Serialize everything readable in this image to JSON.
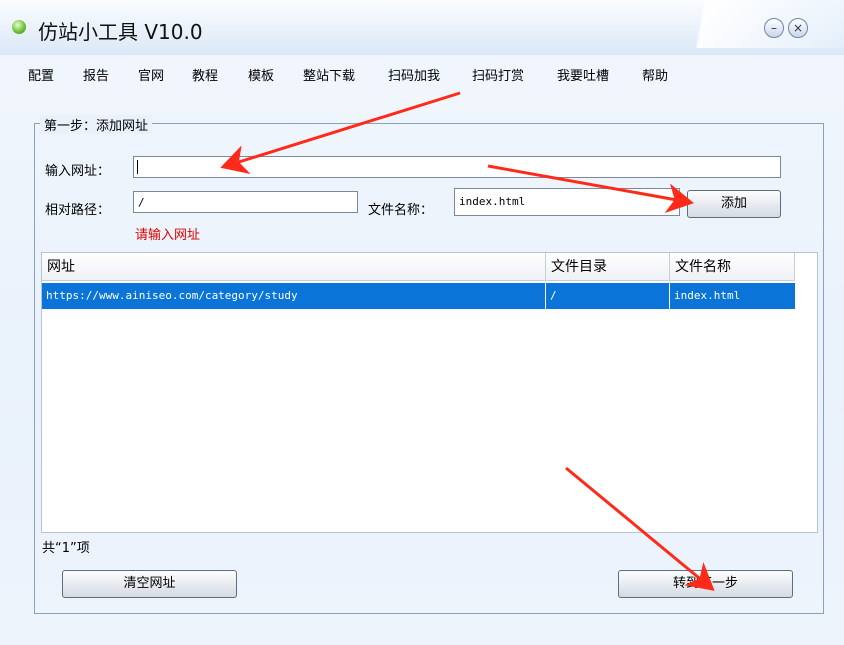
{
  "window": {
    "title": "仿站小工具 V10.0",
    "controls": {
      "minimize": "–",
      "close": "×"
    }
  },
  "menu": [
    "配置",
    "报告",
    "官网",
    "教程",
    "模板",
    "整站下载",
    "扫码加我",
    "扫码打赏",
    "我要吐槽",
    "帮助"
  ],
  "step": {
    "legend": "第一步：添加网址",
    "url_label": "输入网址：",
    "url_value": "",
    "path_label": "相对路径：",
    "path_value": "/",
    "filename_label": "文件名称：",
    "filename_value": "index.html",
    "add_button": "添加",
    "error": "请输入网址"
  },
  "table": {
    "columns": [
      "网址",
      "文件目录",
      "文件名称"
    ],
    "rows": [
      {
        "url": "https://www.ainiseo.com/category/study",
        "dir": "/",
        "file": "index.html",
        "selected": true
      }
    ]
  },
  "footer": {
    "count_text": "共“1”项",
    "clear_button": "清空网址",
    "next_button": "转到下一步"
  },
  "colors": {
    "selection": "#0a74d8",
    "error": "#e00000",
    "annotation_arrow": "#ff2a1a"
  }
}
